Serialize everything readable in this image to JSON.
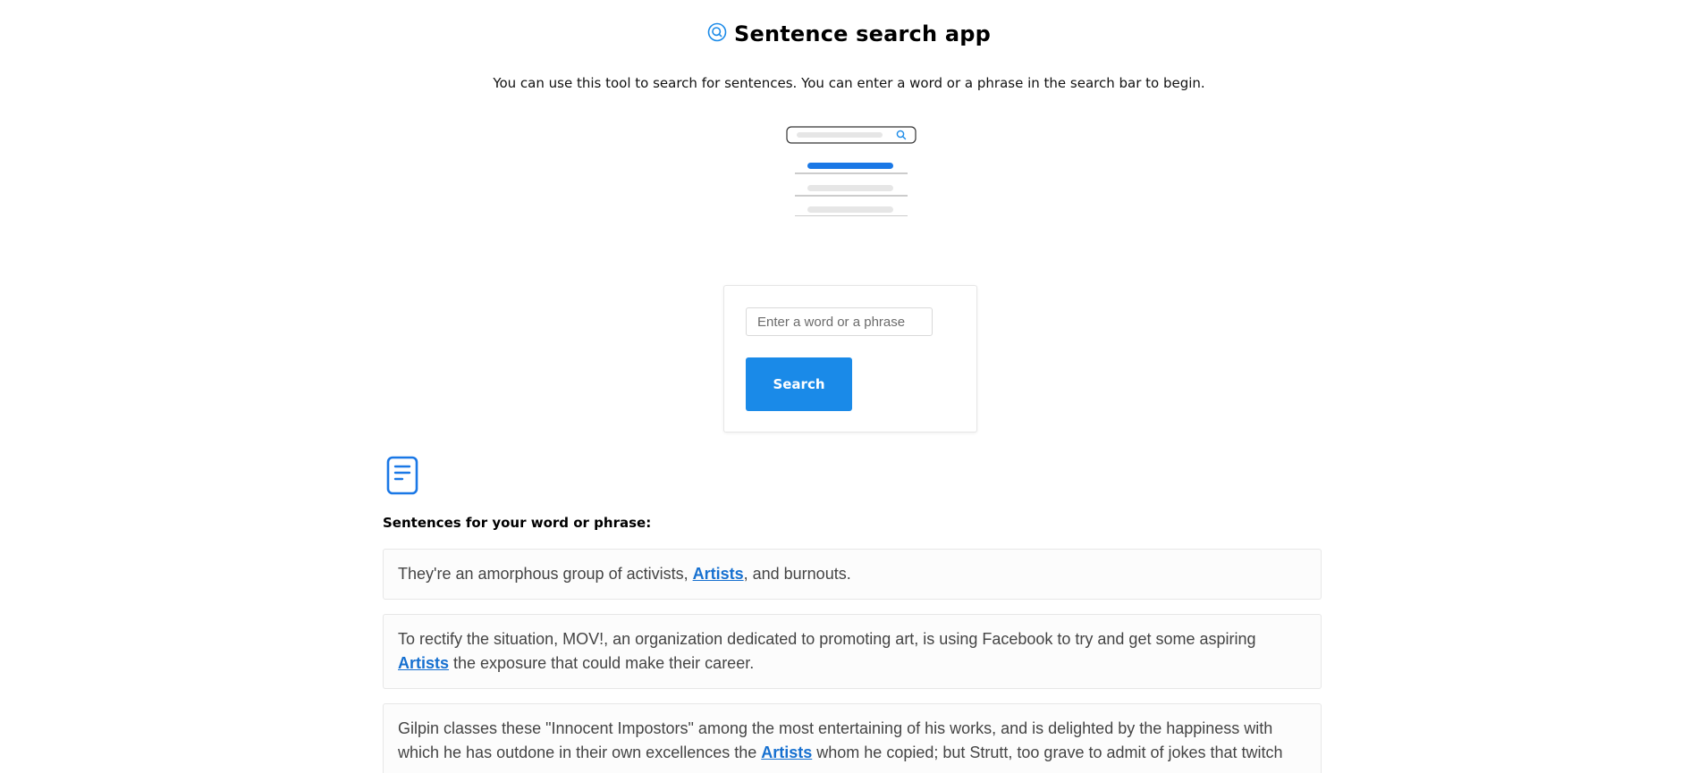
{
  "header": {
    "title": "Sentence search app",
    "icon": "search-person-icon",
    "subtitle": "You can use this tool to search for sentences. You can enter a word or a phrase in the search bar to begin."
  },
  "illustration": {
    "icon": "search-results-illustration"
  },
  "search": {
    "placeholder": "Enter a word or a phrase",
    "value": "",
    "button_label": "Search"
  },
  "results": {
    "icon": "document-icon",
    "heading": "Sentences for your word or phrase:",
    "items": [
      {
        "before": "They're an amorphous group of activists, ",
        "match": "Artists",
        "after": ", and burnouts."
      },
      {
        "before": "To rectify the situation, MOV!, an organization dedicated to promoting art, is using Facebook to try and get some aspiring ",
        "match": "Artists",
        "after": " the exposure that could make their career."
      },
      {
        "before": "Gilpin classes these \"Innocent Impostors\" among the most entertaining of his works, and is delighted by the happiness with which he has outdone in their own excellences the ",
        "match": "Artists",
        "after": " whom he copied; but Strutt, too grave to admit of jokes that twitch"
      }
    ]
  },
  "colors": {
    "accent": "#1a8ae8",
    "link": "#1670d0",
    "card_border": "#e7e7e7"
  }
}
